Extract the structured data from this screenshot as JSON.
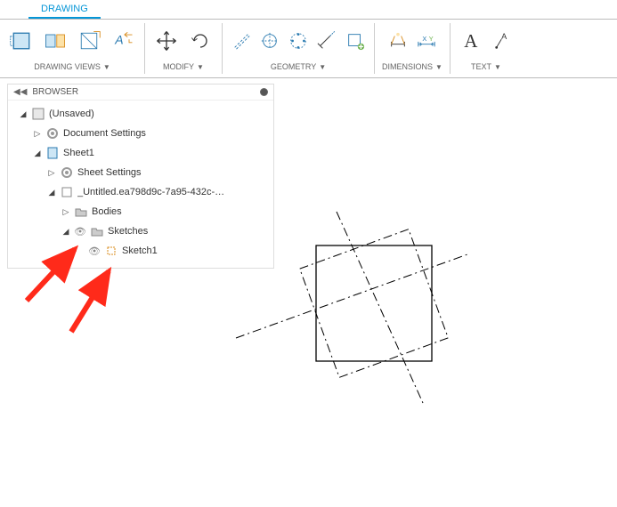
{
  "tab": {
    "label": "DRAWING"
  },
  "ribbon": {
    "views": "DRAWING VIEWS",
    "modify": "MODIFY",
    "geometry": "GEOMETRY",
    "dimensions": "DIMENSIONS",
    "text": "TEXT"
  },
  "browser": {
    "title": "BROWSER",
    "nodes": {
      "root": "(Unsaved)",
      "docset": "Document Settings",
      "sheet": "Sheet1",
      "sheetset": "Sheet Settings",
      "untitled": "_Untitled.ea798d9c-7a95-432c-…",
      "bodies": "Bodies",
      "sketches": "Sketches",
      "sketch1": "Sketch1"
    }
  }
}
